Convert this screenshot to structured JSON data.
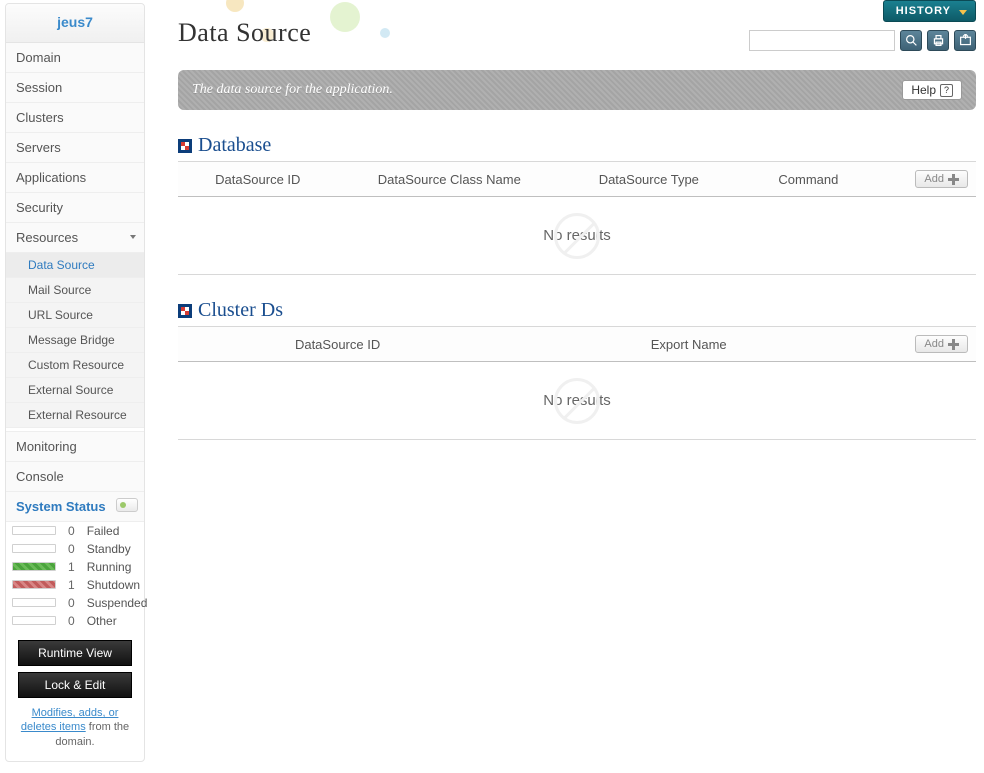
{
  "sidebar": {
    "logo": "jeus7",
    "items": [
      {
        "label": "Domain"
      },
      {
        "label": "Session"
      },
      {
        "label": "Clusters"
      },
      {
        "label": "Servers"
      },
      {
        "label": "Applications"
      },
      {
        "label": "Security"
      },
      {
        "label": "Resources",
        "expanded": true
      }
    ],
    "resource_sub": [
      {
        "label": "Data Source",
        "active": true
      },
      {
        "label": "Mail Source"
      },
      {
        "label": "URL Source"
      },
      {
        "label": "Message Bridge"
      },
      {
        "label": "Custom Resource"
      },
      {
        "label": "External Source"
      },
      {
        "label": "External Resource"
      }
    ],
    "items2": [
      {
        "label": "Monitoring"
      },
      {
        "label": "Console"
      }
    ],
    "system_status_label": "System Status",
    "status_rows": [
      {
        "count": 0,
        "label": "Failed",
        "cls": ""
      },
      {
        "count": 0,
        "label": "Standby",
        "cls": ""
      },
      {
        "count": 1,
        "label": "Running",
        "cls": "running"
      },
      {
        "count": 1,
        "label": "Shutdown",
        "cls": "shutdown"
      },
      {
        "count": 0,
        "label": "Suspended",
        "cls": ""
      },
      {
        "count": 0,
        "label": "Other",
        "cls": ""
      }
    ],
    "btn_runtime": "Runtime View",
    "btn_lockedit": "Lock & Edit",
    "note_link": "Modifies, adds, or deletes items",
    "note_rest": " from the domain."
  },
  "main": {
    "title": "Data Source",
    "history_label": "HISTORY",
    "info_text": "The data source for the application.",
    "help_label": "Help",
    "help_q": "?",
    "add_label": "Add",
    "no_results": "No results",
    "sections": {
      "database": {
        "title": "Database",
        "cols": [
          "DataSource ID",
          "DataSource Class Name",
          "DataSource Type",
          "Command"
        ]
      },
      "clusterds": {
        "title": "Cluster Ds",
        "cols": [
          "DataSource ID",
          "Export Name"
        ]
      }
    }
  }
}
